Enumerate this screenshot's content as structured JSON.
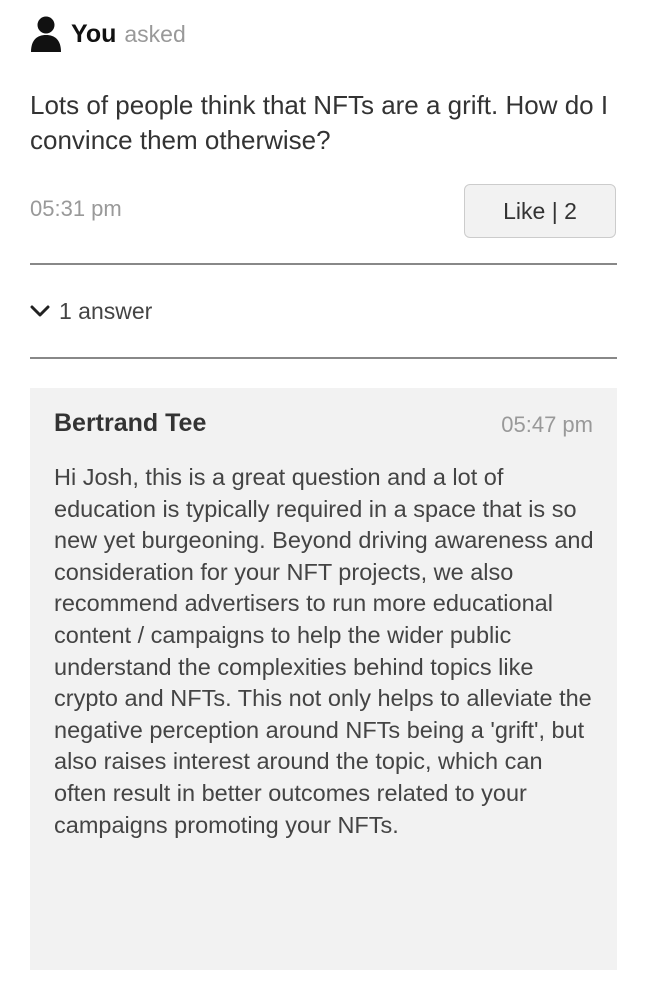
{
  "question": {
    "author": "You",
    "asked_label": "asked",
    "text": "Lots of people think that NFTs are a grift. How do I convince them otherwise?",
    "time": "05:31 pm",
    "like_label": "Like | 2"
  },
  "answers_toggle": {
    "label": "1 answer",
    "icon": "chevron-down-icon"
  },
  "answers": [
    {
      "author": "Bertrand Tee",
      "time": "05:47 pm",
      "text": "Hi Josh, this is a great question and a lot of education is typically required in a space that is so new yet burgeoning. Beyond driving awareness and consideration for your NFT projects, we also recommend advertisers to run more educational content / campaigns to help the wider public understand the complexities behind topics like crypto and NFTs. This not only helps to alleviate the negative perception around NFTs being a 'grift', but also raises interest around the topic, which can often result in better outcomes related to your campaigns promoting your NFTs."
    }
  ],
  "icons": {
    "user": "user-icon"
  },
  "colors": {
    "text": "#333333",
    "muted": "#999999",
    "card_background": "#f2f2f2",
    "divider": "#888888"
  }
}
